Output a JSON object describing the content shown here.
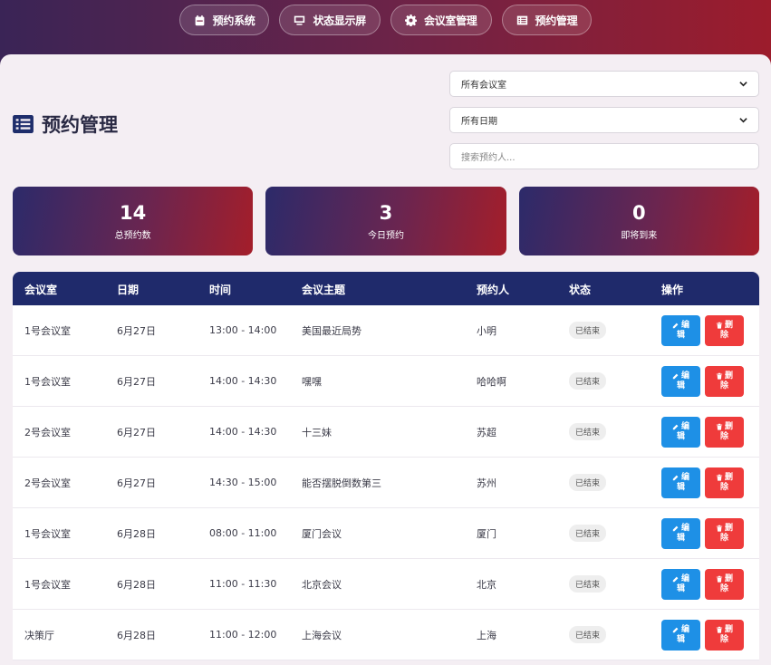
{
  "nav": [
    {
      "label": "预约系统",
      "icon": "calendar-icon"
    },
    {
      "label": "状态显示屏",
      "icon": "monitor-icon"
    },
    {
      "label": "会议室管理",
      "icon": "gear-icon"
    },
    {
      "label": "预约管理",
      "icon": "list-icon"
    }
  ],
  "page": {
    "title": "预约管理",
    "title_icon": "list-icon"
  },
  "filters": {
    "room_selected": "所有会议室",
    "date_selected": "所有日期",
    "search_placeholder": "搜索预约人..."
  },
  "stats": [
    {
      "value": "14",
      "label": "总预约数"
    },
    {
      "value": "3",
      "label": "今日预约"
    },
    {
      "value": "0",
      "label": "即将到来"
    }
  ],
  "table": {
    "headers": [
      "会议室",
      "日期",
      "时间",
      "会议主题",
      "预约人",
      "状态",
      "操作"
    ],
    "edit_label_1": "编",
    "edit_label_2": "辑",
    "delete_label_1": "删",
    "delete_label_2": "除",
    "rows": [
      {
        "room": "1号会议室",
        "date": "6月27日",
        "time": "13:00 - 14:00",
        "topic": "美国最近局势",
        "user": "小明",
        "status": "已结束"
      },
      {
        "room": "1号会议室",
        "date": "6月27日",
        "time": "14:00 - 14:30",
        "topic": "嘿嘿",
        "user": "哈哈啊",
        "status": "已结束"
      },
      {
        "room": "2号会议室",
        "date": "6月27日",
        "time": "14:00 - 14:30",
        "topic": "十三妹",
        "user": "苏超",
        "status": "已结束"
      },
      {
        "room": "2号会议室",
        "date": "6月27日",
        "time": "14:30 - 15:00",
        "topic": "能否摆脱倒数第三",
        "user": "苏州",
        "status": "已结束"
      },
      {
        "room": "1号会议室",
        "date": "6月28日",
        "time": "08:00 - 11:00",
        "topic": "厦门会议",
        "user": "厦门",
        "status": "已结束"
      },
      {
        "room": "1号会议室",
        "date": "6月28日",
        "time": "11:00 - 11:30",
        "topic": "北京会议",
        "user": "北京",
        "status": "已结束"
      },
      {
        "room": "决策厅",
        "date": "6月28日",
        "time": "11:00 - 12:00",
        "topic": "上海会议",
        "user": "上海",
        "status": "已结束"
      }
    ]
  }
}
